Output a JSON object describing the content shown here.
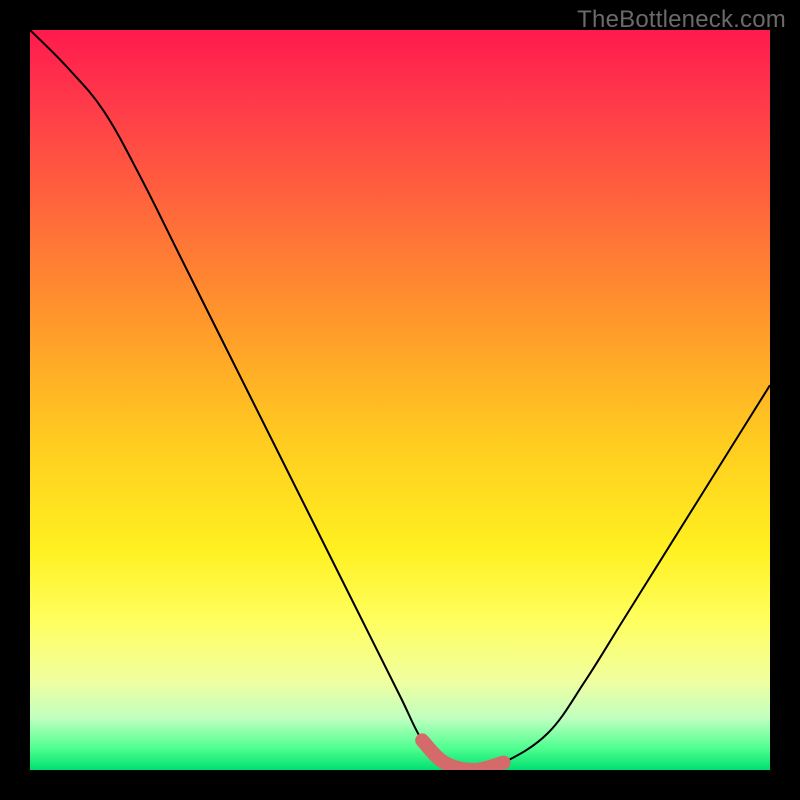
{
  "watermark": "TheBottleneck.com",
  "chart_data": {
    "type": "line",
    "title": "",
    "xlabel": "",
    "ylabel": "",
    "xlim": [
      0,
      100
    ],
    "ylim": [
      0,
      100
    ],
    "grid": false,
    "legend": false,
    "series": [
      {
        "name": "bottleneck-curve",
        "color": "#000000",
        "x": [
          0,
          5,
          10,
          15,
          20,
          25,
          30,
          35,
          40,
          45,
          50,
          53,
          56,
          60,
          64,
          70,
          75,
          80,
          85,
          90,
          95,
          100
        ],
        "y": [
          100,
          95,
          89,
          80,
          70,
          60,
          50,
          40,
          30,
          20,
          10,
          4,
          1,
          0,
          1,
          5,
          12,
          20,
          28,
          36,
          44,
          52
        ]
      },
      {
        "name": "bottom-highlight",
        "color": "#d46a6a",
        "x": [
          53,
          56,
          60,
          64
        ],
        "y": [
          4,
          1,
          0,
          1
        ]
      }
    ],
    "annotations": []
  }
}
